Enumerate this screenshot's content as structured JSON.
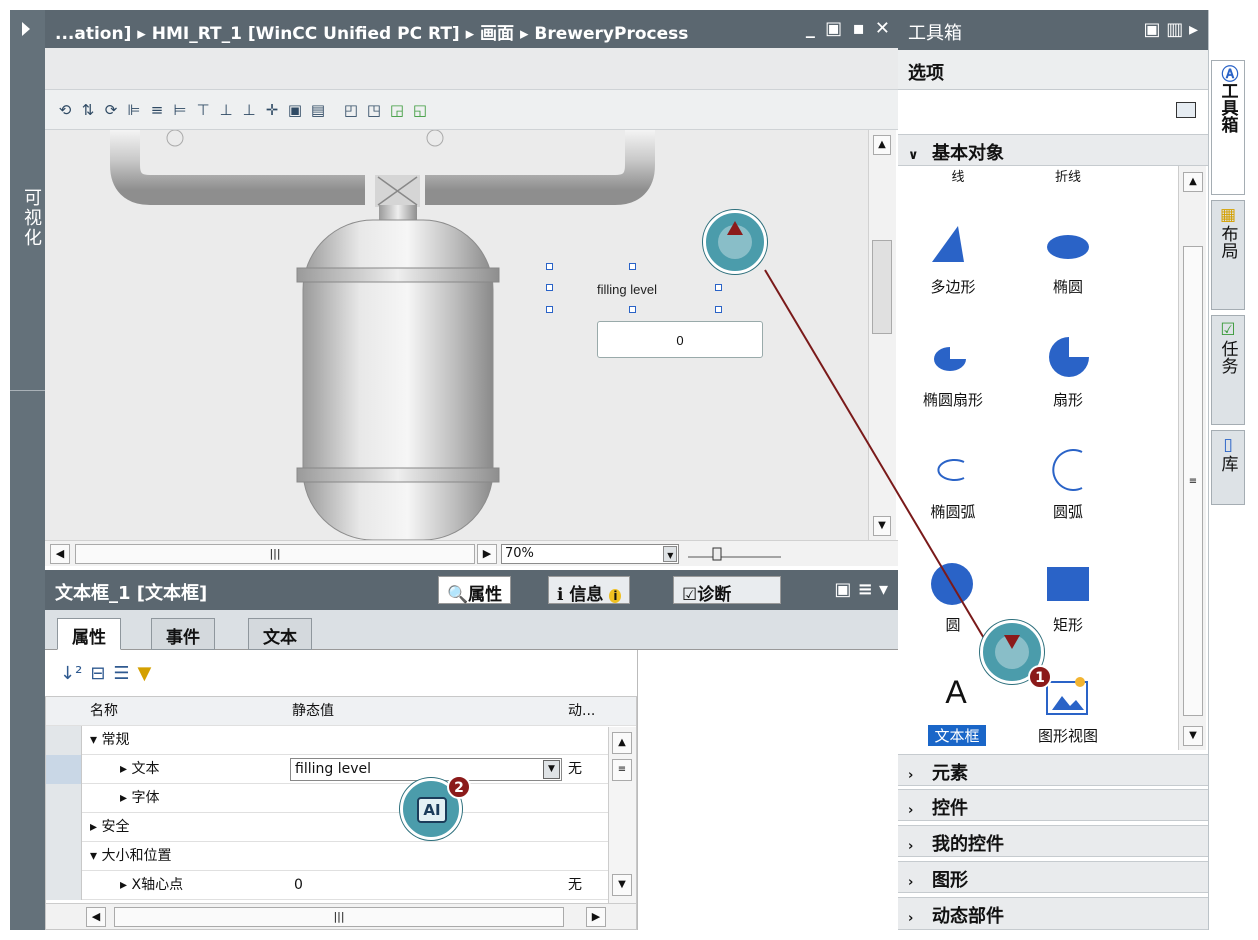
{
  "editor": {
    "sidebar_label": "可视化",
    "title_path": "...ation] ▸ HMI_RT_1 [WinCC Unified PC RT] ▸ 画面 ▸ BreweryProcess",
    "window_controls": "_ ▣ ▪ ✕",
    "zoom_value": "70%",
    "widget_label": "filling level",
    "widget_value": "0"
  },
  "properties": {
    "title": "文本框_1 [文本框]",
    "tab_properties": "属性",
    "tab_info": "信息",
    "tab_diagnostics": "诊断",
    "subtabs": [
      "属性",
      "事件",
      "文本"
    ],
    "columns": {
      "name": "名称",
      "static": "静态值",
      "dynamic": "动..."
    },
    "rows": [
      {
        "name": "▾ 常规",
        "value": "",
        "dyn": ""
      },
      {
        "name": "▸ 文本",
        "value": "filling level",
        "dyn": "无"
      },
      {
        "name": "▸ 字体",
        "value": "",
        "dyn": ""
      },
      {
        "name": "▸ 安全",
        "value": "",
        "dyn": ""
      },
      {
        "name": "▾ 大小和位置",
        "value": "",
        "dyn": ""
      },
      {
        "name": "▸ X轴心点",
        "value": "0",
        "dyn": "无"
      }
    ]
  },
  "toolbox": {
    "title": "工具箱",
    "options_label": "选项",
    "category_basic": "基本对象",
    "partial_labels": {
      "line": "线",
      "polyline": "折线"
    },
    "items": [
      {
        "label": "多边形",
        "icon": "polygon-icon"
      },
      {
        "label": "椭圆",
        "icon": "ellipse-icon"
      },
      {
        "label": "椭圆扇形",
        "icon": "ellipse-sector-icon"
      },
      {
        "label": "扇形",
        "icon": "sector-icon"
      },
      {
        "label": "椭圆弧",
        "icon": "ellipse-arc-icon"
      },
      {
        "label": "圆弧",
        "icon": "circle-arc-icon"
      },
      {
        "label": "圆",
        "icon": "circle-icon"
      },
      {
        "label": "矩形",
        "icon": "rectangle-icon"
      },
      {
        "label": "文本框",
        "icon": "textbox-icon"
      },
      {
        "label": "图形视图",
        "icon": "graphic-view-icon"
      }
    ],
    "textbox_glyph": "A",
    "categories": [
      "元素",
      "控件",
      "我的控件",
      "图形",
      "动态部件"
    ]
  },
  "right_tabs": [
    "工具箱",
    "布局",
    "任务",
    "库"
  ],
  "callouts": {
    "step1": "1",
    "step2": "2",
    "step2_glyph": "AI"
  },
  "accent_colors": {
    "titlebar": "#5b6770",
    "selection": "#1a66c8",
    "callout": "#4b9cab",
    "badge": "#8b1a1a"
  }
}
